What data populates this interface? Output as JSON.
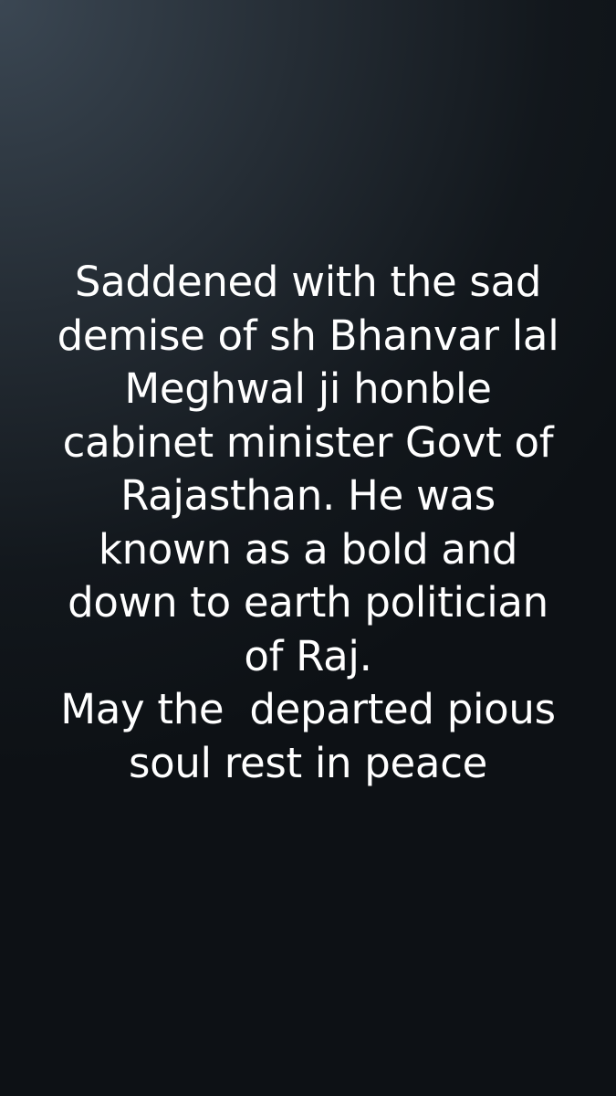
{
  "post": {
    "lines": [
      "Saddened with the sad",
      "demise of sh Bhanvar lal",
      "Meghwal ji honble",
      "cabinet minister Govt of",
      "Rajasthan. He was",
      "known as a bold and",
      "down to earth politician",
      "of Raj.",
      "May the  departed pious",
      "soul rest in peace"
    ]
  },
  "colors": {
    "text": "#ffffff",
    "background_light": "#3b4753",
    "background_dark": "#0d1115"
  }
}
